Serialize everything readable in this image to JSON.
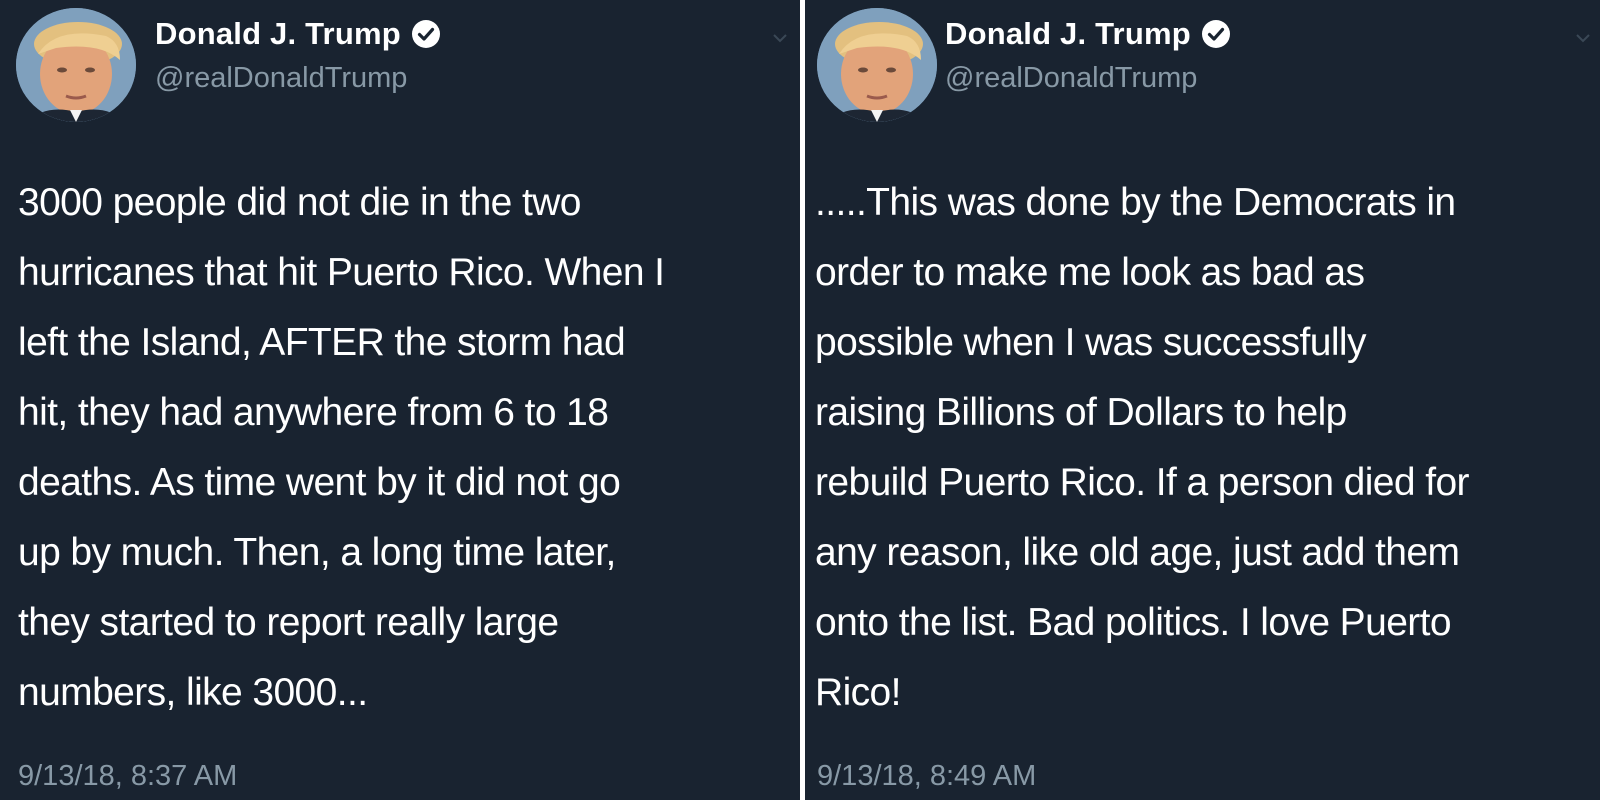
{
  "tweets": [
    {
      "display_name": "Donald J. Trump",
      "handle": "@realDonaldTrump",
      "text": "3000 people did not die in the two\nhurricanes that hit Puerto Rico. When I\nleft the Island, AFTER the storm had\nhit, they had anywhere from 6 to 18\ndeaths. As time went by it did not go\nup by much. Then, a long time later,\nthey started to report really large\nnumbers, like 3000...",
      "timestamp": "9/13/18, 8:37 AM",
      "icons": [
        "avatar",
        "verified-icon",
        "chevron-down-icon"
      ]
    },
    {
      "display_name": "Donald J. Trump",
      "handle": "@realDonaldTrump",
      "text": ".....This was done by the Democrats in\norder to make me look as bad as\npossible when I was successfully\nraising Billions of Dollars to help\nrebuild Puerto Rico. If a person died for\nany reason, like old age, just add them\nonto the list. Bad politics. I love Puerto\nRico!",
      "timestamp": "9/13/18, 8:49 AM",
      "icons": [
        "avatar",
        "verified-icon",
        "chevron-down-icon"
      ]
    }
  ],
  "colors": {
    "background": "#192330",
    "primary_text": "#ffffff",
    "secondary_text": "#8899a6",
    "divider": "#ffffff"
  }
}
